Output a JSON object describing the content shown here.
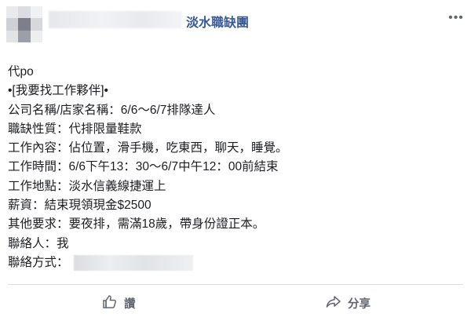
{
  "header": {
    "group_name": "淡水職缺團",
    "more_glyph": "•••"
  },
  "post": {
    "lines": [
      "代po",
      "•[我要找工作夥伴]•",
      "公司名稱/店家名稱：6/6～6/7排隊達人",
      "職缺性質：代排限量鞋款",
      "工作內容：佔位置，滑手機，吃東西，聊天，睡覺。",
      "工作時間：6/6下午13：30～6/7中午12：00前結束",
      "工作地點：淡水信義線捷運上",
      "薪資：結束現領現金$2500",
      "其他要求：要夜排，需滿18歲，帶身份證正本。",
      "聯絡人：我",
      "聯絡方式："
    ]
  },
  "actions": {
    "like_label": "讚",
    "share_label": "分享"
  },
  "colors": {
    "group_link": "#385898",
    "text": "#1c1e21",
    "action": "#606770",
    "divider": "#dadde1"
  }
}
